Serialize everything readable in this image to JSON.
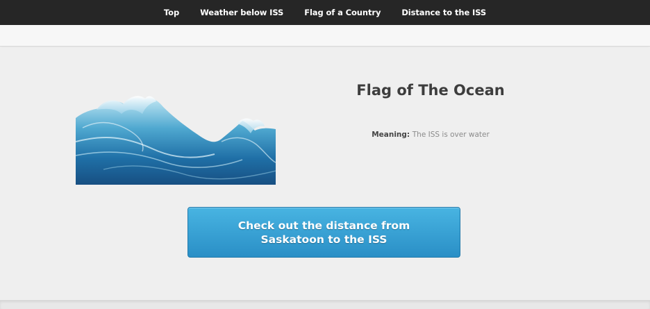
{
  "nav": {
    "items": [
      {
        "label": "Top"
      },
      {
        "label": "Weather below ISS"
      },
      {
        "label": "Flag of a Country"
      },
      {
        "label": "Distance to the ISS"
      }
    ]
  },
  "flag": {
    "title": "Flag of The Ocean",
    "meaning_label": "Meaning:",
    "meaning_value": "The ISS is over water",
    "image_icon": "ocean-wave-image"
  },
  "cta": {
    "label": "Check out the distance from Saskatoon to the ISS"
  },
  "colors": {
    "navbar": "#262626",
    "button": "#3aa3d6",
    "background": "#efefef"
  }
}
